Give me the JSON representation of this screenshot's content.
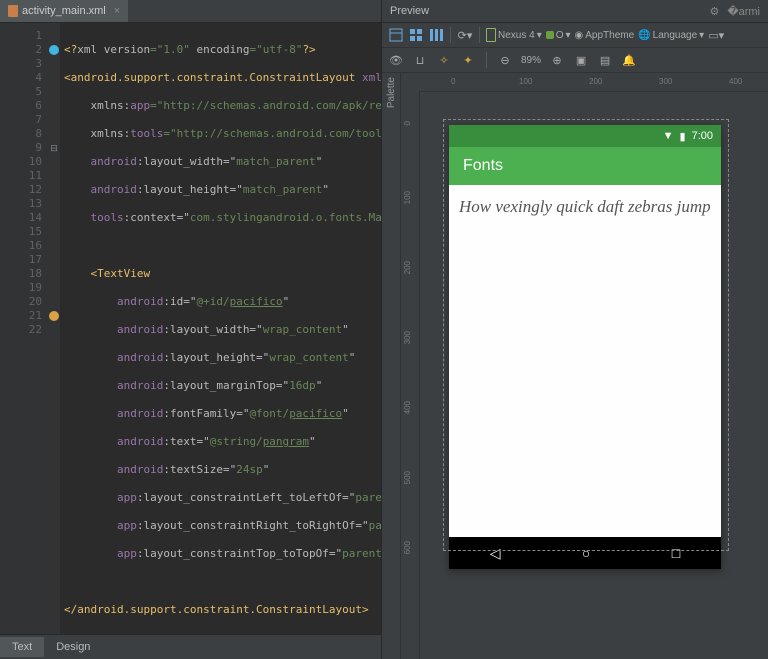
{
  "tabs": {
    "file": "activity_main.xml"
  },
  "gutter_lines": [
    "1",
    "2",
    "3",
    "4",
    "5",
    "6",
    "7",
    "8",
    "9",
    "10",
    "11",
    "12",
    "13",
    "14",
    "15",
    "16",
    "17",
    "18",
    "19",
    "20",
    "21",
    "22"
  ],
  "code": {
    "l1a": "<?",
    "l1b": "xml version",
    "l1c": "=\"1.0\" ",
    "l1d": "encoding",
    "l1e": "=\"utf-8\"",
    "l1f": "?>",
    "l2a": "<",
    "l2b": "android.support.constraint.ConstraintLayout ",
    "l2c": "xmlns:",
    "l3a": "    xmlns:",
    "l3b": "app",
    "l3c": "=\"http://schemas.android.com/apk/res-aut",
    "l4a": "    xmlns:",
    "l4b": "tools",
    "l4c": "=\"http://schemas.android.com/tools\"",
    "l5a": "    ",
    "l5b": "android",
    "l5c": ":layout_width=\"",
    "l5d": "match_parent",
    "l5e": "\"",
    "l6a": "    ",
    "l6b": "android",
    "l6c": ":layout_height=\"",
    "l6d": "match_parent",
    "l6e": "\"",
    "l7a": "    ",
    "l7b": "tools",
    "l7c": ":context=\"",
    "l7d": "com.stylingandroid.o.fonts.MainAct",
    "l9a": "    <",
    "l9b": "TextView",
    "l10a": "        ",
    "l10b": "android",
    "l10c": ":id=\"",
    "l10d": "@+id/",
    "l10e": "pacifico",
    "l10f": "\"",
    "l11a": "        ",
    "l11b": "android",
    "l11c": ":layout_width=\"",
    "l11d": "wrap_content",
    "l11e": "\"",
    "l12a": "        ",
    "l12b": "android",
    "l12c": ":layout_height=\"",
    "l12d": "wrap_content",
    "l12e": "\"",
    "l13a": "        ",
    "l13b": "android",
    "l13c": ":layout_marginTop=\"",
    "l13d": "16dp",
    "l13e": "\"",
    "l14a": "        ",
    "l14b": "android",
    "l14c": ":fontFamily=\"",
    "l14d": "@font/",
    "l14e": "pacifico",
    "l14f": "\"",
    "l15a": "        ",
    "l15b": "android",
    "l15c": ":text=\"",
    "l15d": "@string/",
    "l15e": "pangram",
    "l15f": "\"",
    "l16a": "        ",
    "l16b": "android",
    "l16c": ":textSize=\"",
    "l16d": "24sp",
    "l16e": "\"",
    "l17a": "        ",
    "l17b": "app",
    "l17c": ":layout_constraintLeft_toLeftOf=\"",
    "l17d": "parent",
    "l17e": "\"",
    "l18a": "        ",
    "l18b": "app",
    "l18c": ":layout_constraintRight_toRightOf=\"",
    "l18d": "parent",
    "l18e": "\"",
    "l19a": "        ",
    "l19b": "app",
    "l19c": ":layout_constraintTop_toTopOf=\"",
    "l19d": "parent",
    "l19e": "\" />",
    "l21a": "</",
    "l21b": "android.support.constraint.ConstraintLayout",
    "l21c": ">"
  },
  "bottom": {
    "text": "Text",
    "design": "Design"
  },
  "preview": {
    "title": "Preview",
    "device": "Nexus 4",
    "api": "O",
    "theme": "AppTheme",
    "lang": "Language",
    "zoom": "89%",
    "status_time": "7:00",
    "app_title": "Fonts",
    "pangram": "How vexingly quick daft zebras jump",
    "palette": "Palette",
    "ruler_h": [
      "0",
      "100",
      "200",
      "300",
      "400"
    ],
    "ruler_v": [
      "0",
      "100",
      "200",
      "300",
      "400",
      "500",
      "600"
    ]
  }
}
